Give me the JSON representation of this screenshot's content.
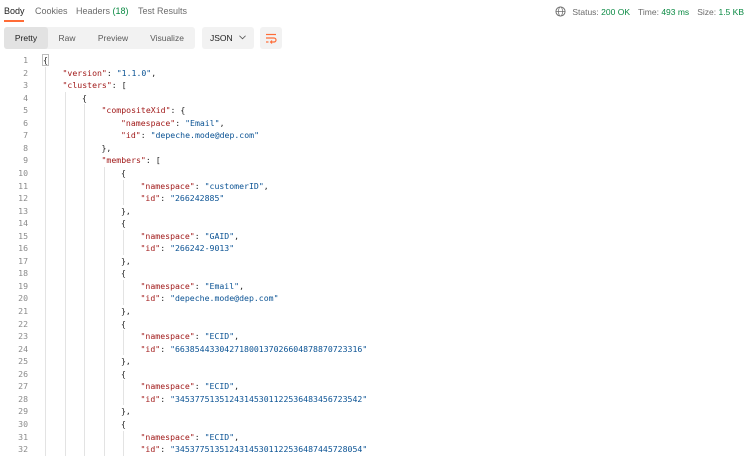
{
  "tabs": [
    {
      "label": "Body",
      "active": true
    },
    {
      "label": "Cookies",
      "active": false
    },
    {
      "label": "Headers",
      "count": "(18)",
      "active": false
    },
    {
      "label": "Test Results",
      "active": false
    }
  ],
  "status": {
    "status_label": "Status:",
    "status_value": "200 OK",
    "time_label": "Time:",
    "time_value": "493 ms",
    "size_label": "Size:",
    "size_value": "1.5 KB",
    "icon": "globe-icon"
  },
  "toolbar": {
    "views": [
      "Pretty",
      "Raw",
      "Preview",
      "Visualize"
    ],
    "active_view": "Pretty",
    "format": "JSON",
    "wrap_icon": "wrap-lines-icon"
  },
  "code_lines": [
    {
      "n": "1",
      "indent": 0,
      "parts": [
        [
          "p",
          "{"
        ]
      ]
    },
    {
      "n": "2",
      "indent": 1,
      "parts": [
        [
          "k",
          "\"version\""
        ],
        [
          "p",
          ": "
        ],
        [
          "s",
          "\"1.1.0\""
        ],
        [
          "p",
          ","
        ]
      ]
    },
    {
      "n": "3",
      "indent": 1,
      "parts": [
        [
          "k",
          "\"clusters\""
        ],
        [
          "p",
          ": ["
        ]
      ]
    },
    {
      "n": "4",
      "indent": 2,
      "parts": [
        [
          "p",
          "{"
        ]
      ]
    },
    {
      "n": "5",
      "indent": 3,
      "parts": [
        [
          "k",
          "\"compositeXid\""
        ],
        [
          "p",
          ": {"
        ]
      ]
    },
    {
      "n": "6",
      "indent": 4,
      "parts": [
        [
          "k",
          "\"namespace\""
        ],
        [
          "p",
          ": "
        ],
        [
          "s",
          "\"Email\""
        ],
        [
          "p",
          ","
        ]
      ]
    },
    {
      "n": "7",
      "indent": 4,
      "parts": [
        [
          "k",
          "\"id\""
        ],
        [
          "p",
          ": "
        ],
        [
          "s",
          "\"depeche.mode@dep.com\""
        ]
      ]
    },
    {
      "n": "8",
      "indent": 3,
      "parts": [
        [
          "p",
          "},"
        ]
      ]
    },
    {
      "n": "9",
      "indent": 3,
      "parts": [
        [
          "k",
          "\"members\""
        ],
        [
          "p",
          ": ["
        ]
      ]
    },
    {
      "n": "10",
      "indent": 4,
      "parts": [
        [
          "p",
          "{"
        ]
      ]
    },
    {
      "n": "11",
      "indent": 5,
      "parts": [
        [
          "k",
          "\"namespace\""
        ],
        [
          "p",
          ": "
        ],
        [
          "s",
          "\"customerID\""
        ],
        [
          "p",
          ","
        ]
      ]
    },
    {
      "n": "12",
      "indent": 5,
      "parts": [
        [
          "k",
          "\"id\""
        ],
        [
          "p",
          ": "
        ],
        [
          "s",
          "\"266242885\""
        ]
      ]
    },
    {
      "n": "13",
      "indent": 4,
      "parts": [
        [
          "p",
          "},"
        ]
      ]
    },
    {
      "n": "14",
      "indent": 4,
      "parts": [
        [
          "p",
          "{"
        ]
      ]
    },
    {
      "n": "15",
      "indent": 5,
      "parts": [
        [
          "k",
          "\"namespace\""
        ],
        [
          "p",
          ": "
        ],
        [
          "s",
          "\"GAID\""
        ],
        [
          "p",
          ","
        ]
      ]
    },
    {
      "n": "16",
      "indent": 5,
      "parts": [
        [
          "k",
          "\"id\""
        ],
        [
          "p",
          ": "
        ],
        [
          "s",
          "\"266242-9013\""
        ]
      ]
    },
    {
      "n": "17",
      "indent": 4,
      "parts": [
        [
          "p",
          "},"
        ]
      ]
    },
    {
      "n": "18",
      "indent": 4,
      "parts": [
        [
          "p",
          "{"
        ]
      ]
    },
    {
      "n": "19",
      "indent": 5,
      "parts": [
        [
          "k",
          "\"namespace\""
        ],
        [
          "p",
          ": "
        ],
        [
          "s",
          "\"Email\""
        ],
        [
          "p",
          ","
        ]
      ]
    },
    {
      "n": "20",
      "indent": 5,
      "parts": [
        [
          "k",
          "\"id\""
        ],
        [
          "p",
          ": "
        ],
        [
          "s",
          "\"depeche.mode@dep.com\""
        ]
      ]
    },
    {
      "n": "21",
      "indent": 4,
      "parts": [
        [
          "p",
          "},"
        ]
      ]
    },
    {
      "n": "22",
      "indent": 4,
      "parts": [
        [
          "p",
          "{"
        ]
      ]
    },
    {
      "n": "23",
      "indent": 5,
      "parts": [
        [
          "k",
          "\"namespace\""
        ],
        [
          "p",
          ": "
        ],
        [
          "s",
          "\"ECID\""
        ],
        [
          "p",
          ","
        ]
      ]
    },
    {
      "n": "24",
      "indent": 5,
      "parts": [
        [
          "k",
          "\"id\""
        ],
        [
          "p",
          ": "
        ],
        [
          "s",
          "\"66385443304271800137026604878870723316\""
        ]
      ]
    },
    {
      "n": "25",
      "indent": 4,
      "parts": [
        [
          "p",
          "},"
        ]
      ]
    },
    {
      "n": "26",
      "indent": 4,
      "parts": [
        [
          "p",
          "{"
        ]
      ]
    },
    {
      "n": "27",
      "indent": 5,
      "parts": [
        [
          "k",
          "\"namespace\""
        ],
        [
          "p",
          ": "
        ],
        [
          "s",
          "\"ECID\""
        ],
        [
          "p",
          ","
        ]
      ]
    },
    {
      "n": "28",
      "indent": 5,
      "parts": [
        [
          "k",
          "\"id\""
        ],
        [
          "p",
          ": "
        ],
        [
          "s",
          "\"34537751351243145301122536483456723542\""
        ]
      ]
    },
    {
      "n": "29",
      "indent": 4,
      "parts": [
        [
          "p",
          "},"
        ]
      ]
    },
    {
      "n": "30",
      "indent": 4,
      "parts": [
        [
          "p",
          "{"
        ]
      ]
    },
    {
      "n": "31",
      "indent": 5,
      "parts": [
        [
          "k",
          "\"namespace\""
        ],
        [
          "p",
          ": "
        ],
        [
          "s",
          "\"ECID\""
        ],
        [
          "p",
          ","
        ]
      ]
    },
    {
      "n": "32",
      "indent": 5,
      "parts": [
        [
          "k",
          "\"id\""
        ],
        [
          "p",
          ": "
        ],
        [
          "s",
          "\"34537751351243145301122536487445728054\""
        ]
      ]
    }
  ]
}
